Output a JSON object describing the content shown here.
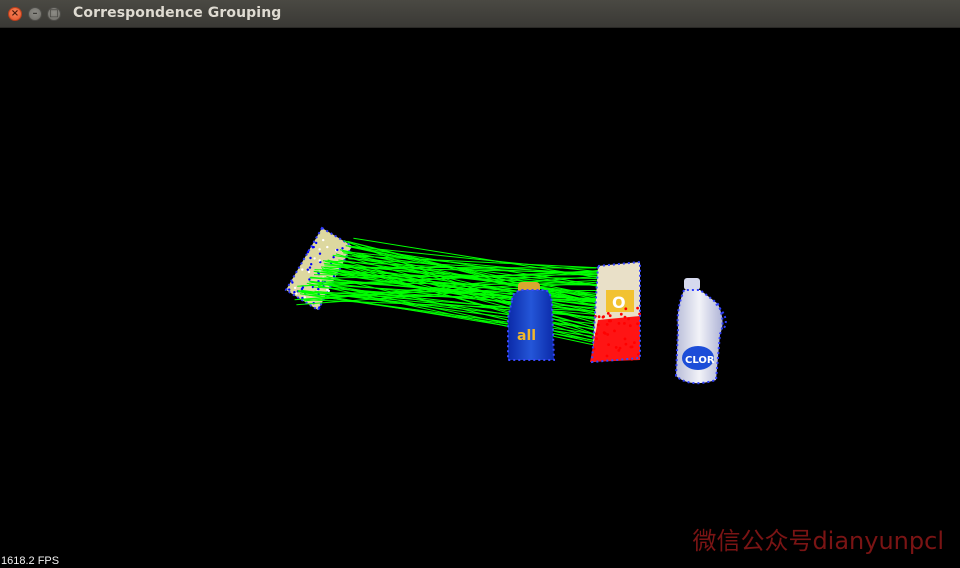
{
  "window": {
    "title": "Correspondence Grouping",
    "buttons": [
      {
        "name": "close",
        "glyph": "×"
      },
      {
        "name": "minimize",
        "glyph": "–"
      },
      {
        "name": "maximize",
        "glyph": "□"
      }
    ]
  },
  "viewer": {
    "fps_text": "1618.2 FPS",
    "watermark": "微信公众号dianyunpcl",
    "background_color": "#000000",
    "colors": {
      "correspondence_lines": "#00ff00",
      "model_keypoints": "#0000ff",
      "scene_keypoints": "#1a1aff",
      "recognized_instance": "#ff0000",
      "model_cloud": "#fff6a8"
    },
    "scene_objects": [
      "model-cereal-box",
      "detergent-bottle",
      "cereal-box",
      "clorox-bottle"
    ]
  }
}
